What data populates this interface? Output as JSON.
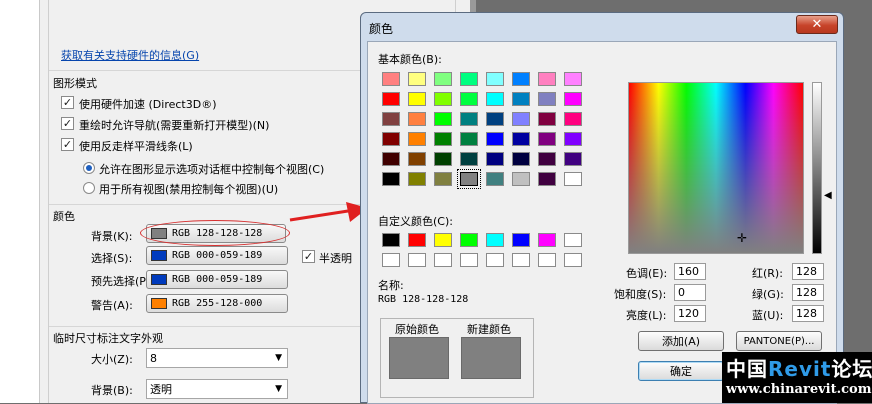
{
  "options_panel": {
    "hardware_link": "获取有关支持硬件的信息(G)",
    "graphics_mode": {
      "title": "图形模式",
      "checkboxes": [
        {
          "label": "使用硬件加速 (Direct3D®)",
          "checked": true
        },
        {
          "label": "重绘时允许导航(需要重新打开模型)(N)",
          "checked": true
        },
        {
          "label": "使用反走样平滑线条(L)",
          "checked": true
        }
      ],
      "radios": [
        {
          "label": "允许在图形显示选项对话框中控制每个视图(C)",
          "selected": true
        },
        {
          "label": "用于所有视图(禁用控制每个视图)(U)",
          "selected": false
        }
      ]
    },
    "colors": {
      "title": "颜色",
      "rows": [
        {
          "label": "背景(K):",
          "value": "RGB 128-128-128",
          "swatch": "#808080"
        },
        {
          "label": "选择(S):",
          "value": "RGB 000-059-189",
          "swatch": "#003bbd"
        },
        {
          "label": "预先选择(P):",
          "value": "RGB 000-059-189",
          "swatch": "#003bbd"
        },
        {
          "label": "警告(A):",
          "value": "RGB 255-128-000",
          "swatch": "#ff8000"
        }
      ],
      "semi_transparent_label": "半透明",
      "semi_transparent_checked": true
    },
    "temp_dim": {
      "title": "临时尺寸标注文字外观",
      "size_label": "大小(Z):",
      "size_value": "8",
      "bg_label": "背景(B):",
      "bg_value": "透明"
    }
  },
  "color_dialog": {
    "title": "颜色",
    "close_glyph": "✕",
    "basic_colors_label": "基本颜色(B):",
    "basic_colors": [
      "#ff8080",
      "#ffff80",
      "#80ff80",
      "#00ff80",
      "#80ffff",
      "#0080ff",
      "#ff80c0",
      "#ff80ff",
      "#ff0000",
      "#ffff00",
      "#80ff00",
      "#00ff40",
      "#00ffff",
      "#0080c0",
      "#8080c0",
      "#ff00ff",
      "#804040",
      "#ff8040",
      "#00ff00",
      "#008080",
      "#004080",
      "#8080ff",
      "#800040",
      "#ff0080",
      "#800000",
      "#ff8000",
      "#008000",
      "#008040",
      "#0000ff",
      "#0000a0",
      "#800080",
      "#8000ff",
      "#400000",
      "#804000",
      "#004000",
      "#004040",
      "#000080",
      "#000040",
      "#400040",
      "#400080",
      "#000000",
      "#808000",
      "#808040",
      "#808080",
      "#408080",
      "#c0c0c0",
      "#400040",
      "#ffffff"
    ],
    "selected_basic_index": 43,
    "custom_colors_label": "自定义颜色(C):",
    "custom_colors": [
      "#000000",
      "#ff0000",
      "#ffff00",
      "#00ff00",
      "#00ffff",
      "#0000ff",
      "#ff00ff",
      "#ffffff",
      "#ffffff",
      "#ffffff",
      "#ffffff",
      "#ffffff",
      "#ffffff",
      "#ffffff",
      "#ffffff",
      "#ffffff"
    ],
    "name_label": "名称:",
    "name_value": "RGB 128-128-128",
    "original_label": "原始颜色",
    "new_label": "新建颜色",
    "preview_color": "#808080",
    "hue_label": "色调(E):",
    "hue_value": "160",
    "sat_label": "饱和度(S):",
    "sat_value": "0",
    "lum_label": "亮度(L):",
    "lum_value": "120",
    "red_label": "红(R):",
    "red_value": "128",
    "green_label": "绿(G):",
    "green_value": "128",
    "blue_label": "蓝(U):",
    "blue_value": "128",
    "add_button": "添加(A)",
    "pantone_button": "PANTONE(P)...",
    "ok_button": "确定"
  },
  "watermark": {
    "cn_prefix": "中国",
    "brand": "Revit",
    "cn_suffix": "论坛",
    "url": "www.chinarevit.com"
  }
}
